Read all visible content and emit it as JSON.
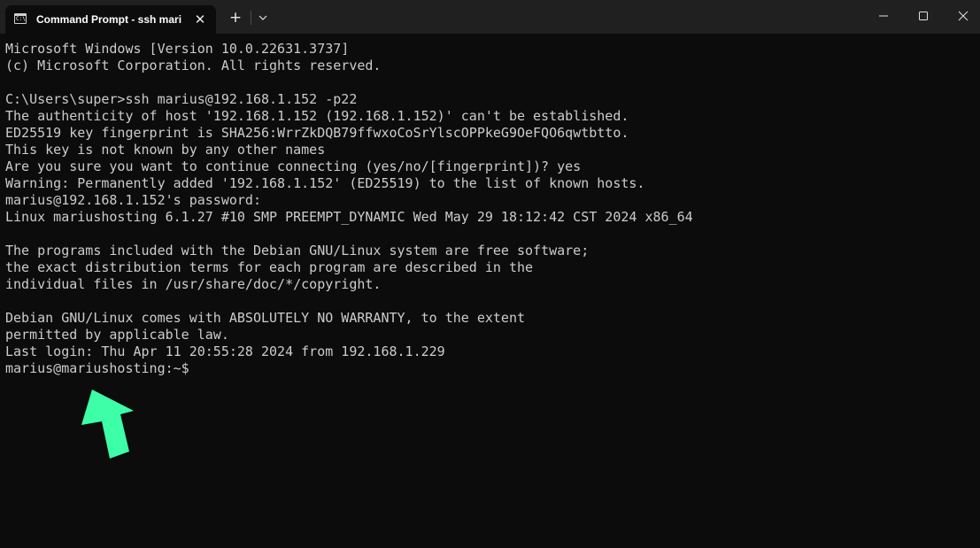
{
  "window": {
    "tab_title": "Command Prompt - ssh  mari",
    "tab_icon": "cmd-icon",
    "new_tab_label": "+",
    "close_tab_label": "✕",
    "controls": [
      "minimize-icon",
      "maximize-icon",
      "close-icon"
    ]
  },
  "terminal": {
    "lines": [
      "Microsoft Windows [Version 10.0.22631.3737]",
      "(c) Microsoft Corporation. All rights reserved.",
      "",
      "C:\\Users\\super>ssh marius@192.168.1.152 -p22",
      "The authenticity of host '192.168.1.152 (192.168.1.152)' can't be established.",
      "ED25519 key fingerprint is SHA256:WrrZkDQB79ffwxoCoSrYlscOPPkeG9OeFQO6qwtbtto.",
      "This key is not known by any other names",
      "Are you sure you want to continue connecting (yes/no/[fingerprint])? yes",
      "Warning: Permanently added '192.168.1.152' (ED25519) to the list of known hosts.",
      "marius@192.168.1.152's password:",
      "Linux mariushosting 6.1.27 #10 SMP PREEMPT_DYNAMIC Wed May 29 18:12:42 CST 2024 x86_64",
      "",
      "The programs included with the Debian GNU/Linux system are free software;",
      "the exact distribution terms for each program are described in the",
      "individual files in /usr/share/doc/*/copyright.",
      "",
      "Debian GNU/Linux comes with ABSOLUTELY NO WARRANTY, to the extent",
      "permitted by applicable law.",
      "Last login: Thu Apr 11 20:55:28 2024 from 192.168.1.229",
      "marius@mariushosting:~$"
    ]
  },
  "colors": {
    "background": "#0c0c0c",
    "titlebar": "#202020",
    "text": "#cccccc",
    "arrow": "#3dffa7"
  },
  "annotation": {
    "icon": "arrow-up-icon"
  }
}
